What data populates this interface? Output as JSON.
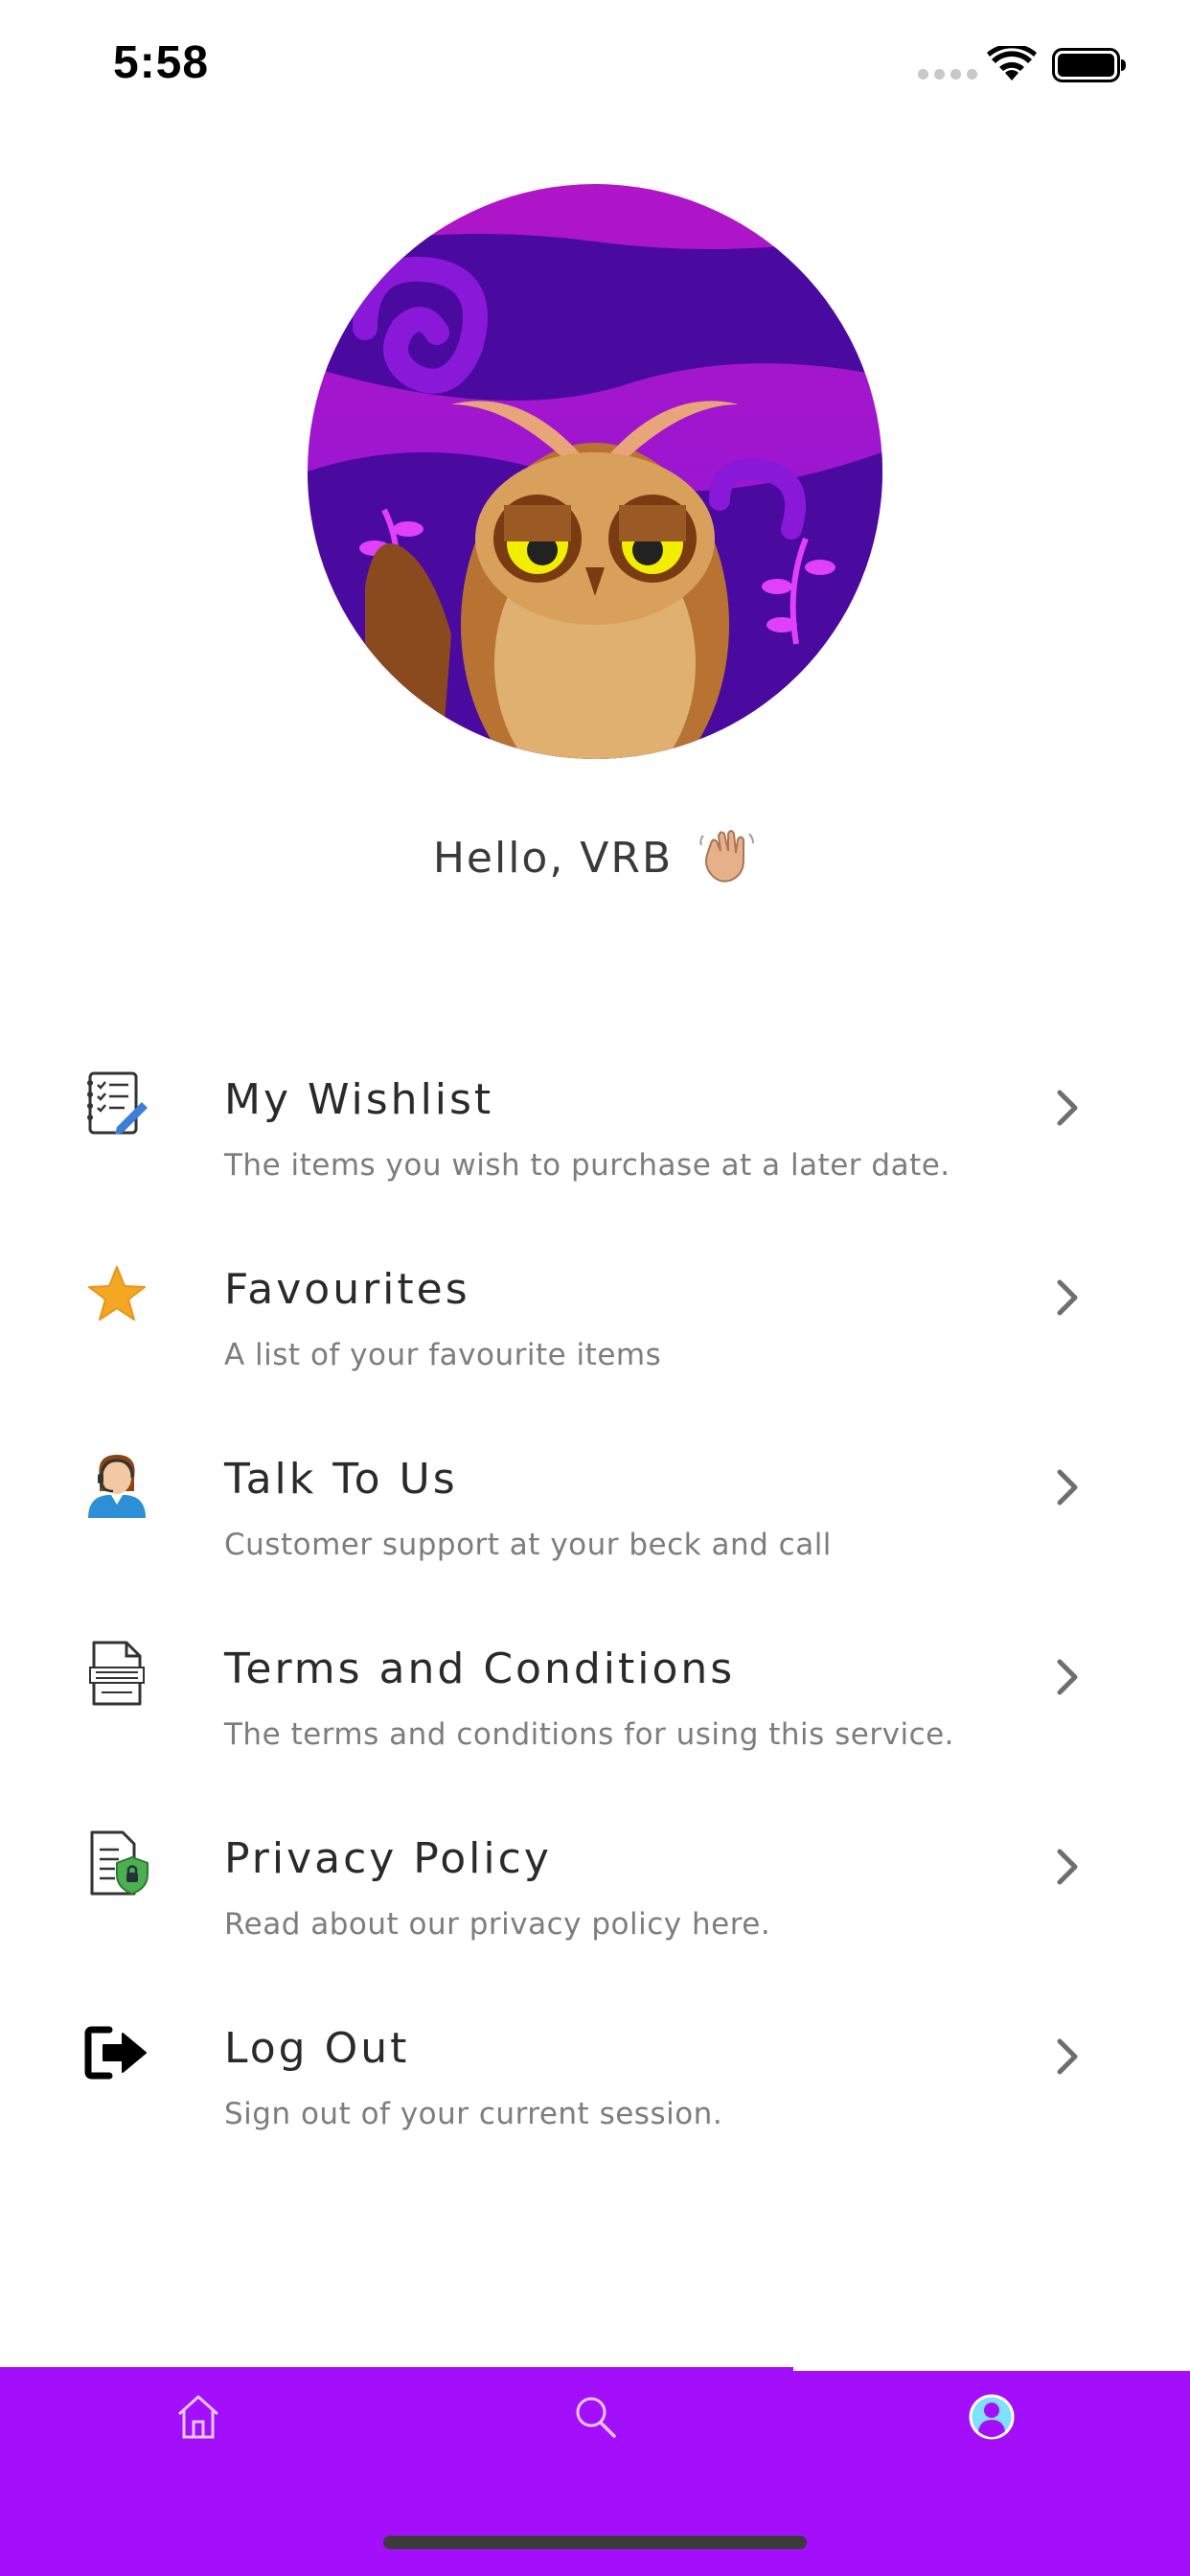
{
  "status_bar": {
    "time": "5:58"
  },
  "profile": {
    "greeting": "Hello, VRB"
  },
  "menu": [
    {
      "title": "My Wishlist",
      "subtitle": "The items you wish to purchase at a later date.",
      "icon": "wishlist-checklist-icon"
    },
    {
      "title": "Favourites",
      "subtitle": "A list of your favourite items",
      "icon": "star-icon"
    },
    {
      "title": "Talk To Us",
      "subtitle": "Customer support at your beck and call",
      "icon": "support-agent-icon"
    },
    {
      "title": "Terms and Conditions",
      "subtitle": "The terms and conditions for using this service.",
      "icon": "terms-document-icon"
    },
    {
      "title": "Privacy Policy",
      "subtitle": "Read about our privacy policy here.",
      "icon": "privacy-shield-icon"
    },
    {
      "title": "Log Out",
      "subtitle": "Sign out of your current session.",
      "icon": "logout-icon"
    }
  ],
  "tab_bar": {
    "tabs": [
      "home-icon",
      "search-icon",
      "profile-icon"
    ],
    "active": "profile-icon"
  },
  "colors": {
    "tab_bar": "#a40ffb",
    "star": "#f5a623",
    "support": "#2d8fd5"
  }
}
